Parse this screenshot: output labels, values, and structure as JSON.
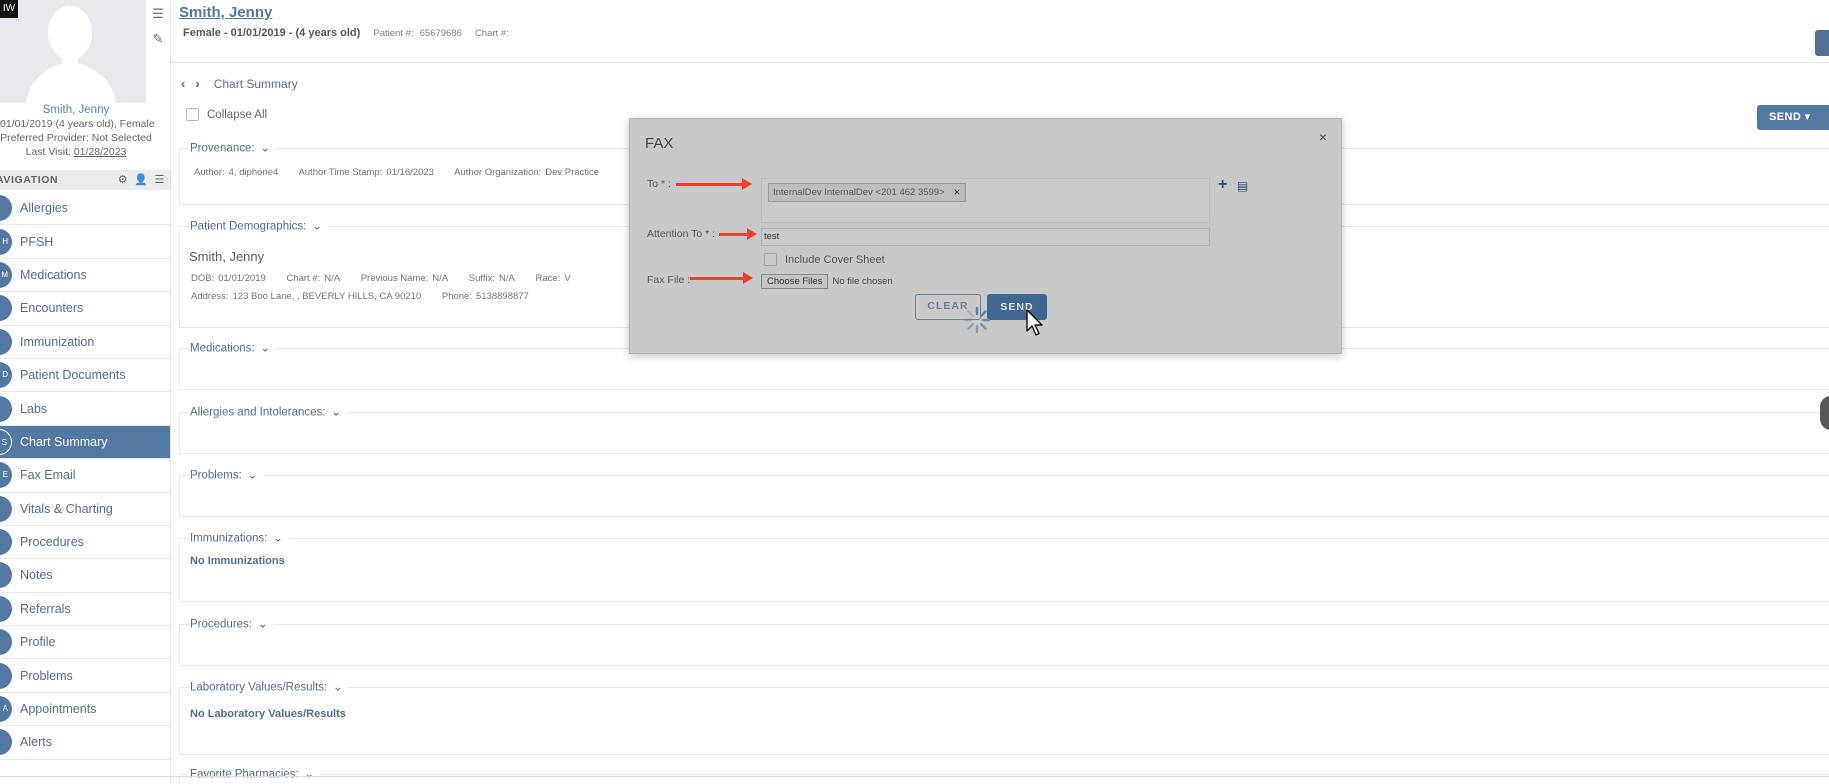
{
  "patient": {
    "name": "Smith, Jenny",
    "summary": "Female - 01/01/2019 - (4 years old)",
    "patient_no_label": "Patient #:",
    "patient_no": "65679686",
    "chart_no_label": "Chart #:"
  },
  "sidebar": {
    "corner_badge": "IW",
    "name": "Smith, Jenny",
    "dob_line": "01/01/2019 (4 years old), Female",
    "provider_line": "Preferred Provider: Not Selected",
    "last_visit_label": "Last Visit:",
    "last_visit_date": "01/28/2023",
    "nav_title": "AVIGATION",
    "items": [
      {
        "badge": "",
        "label": "Allergies"
      },
      {
        "badge": "H",
        "label": "PFSH"
      },
      {
        "badge": "M",
        "label": "Medications"
      },
      {
        "badge": "",
        "label": "Encounters"
      },
      {
        "badge": "",
        "label": "Immunization"
      },
      {
        "badge": "D",
        "label": "Patient Documents"
      },
      {
        "badge": "",
        "label": "Labs"
      },
      {
        "badge": "S",
        "label": "Chart Summary"
      },
      {
        "badge": "E",
        "label": "Fax Email"
      },
      {
        "badge": "",
        "label": "Vitals & Charting"
      },
      {
        "badge": "",
        "label": "Procedures"
      },
      {
        "badge": "",
        "label": "Notes"
      },
      {
        "badge": "",
        "label": "Referrals"
      },
      {
        "badge": "",
        "label": "Profile"
      },
      {
        "badge": "",
        "label": "Problems"
      },
      {
        "badge": "A",
        "label": "Appointments"
      },
      {
        "badge": "",
        "label": "Alerts"
      }
    ]
  },
  "main": {
    "breadcrumb": "Chart Summary",
    "collapse_all": "Collapse All",
    "send_label": "SEND",
    "sections": {
      "provenance": {
        "title": "Provenance:",
        "author_label": "Author:",
        "author": "4, diphone4",
        "timestamp_label": "Author Time Stamp:",
        "timestamp": "01/16/2023",
        "org_label": "Author Organization:",
        "org": "Dev Practice"
      },
      "demographics": {
        "title": "Patient Demographics:",
        "name": "Smith, Jenny",
        "dob_label": "DOB:",
        "dob": "01/01/2019",
        "chart_label": "Chart #:",
        "chart": "N/A",
        "prev_label": "Previous Name:",
        "prev": "N/A",
        "suffix_label": "Suffix:",
        "suffix": "N/A",
        "race_label": "Race:",
        "race": "V",
        "address_label": "Address:",
        "address": "123 Boo Lane, , BEVERLY HILLS, CA 90210",
        "phone_label": "Phone:",
        "phone": "5138898877"
      },
      "medications": {
        "title": "Medications:"
      },
      "allergies": {
        "title": "Allergies and Intolerances:"
      },
      "problems": {
        "title": "Problems:"
      },
      "immunizations": {
        "title": "Immunizations:",
        "body": "No Immunizations"
      },
      "procedures": {
        "title": "Procedures:"
      },
      "labs": {
        "title": "Laboratory Values/Results:",
        "body": "No Laboratory Values/Results"
      },
      "pharmacies": {
        "title": "Favorite Pharmacies:"
      }
    }
  },
  "fax_modal": {
    "title": "FAX",
    "close": "×",
    "to_label": "To * :",
    "to_recipient": "InternalDev InternalDev <201 462 3599>",
    "attention_label": "Attention To * :",
    "attention_value": "test",
    "cover_label": "Include Cover Sheet",
    "file_label": "Fax File :",
    "choose_files": "Choose Files",
    "no_file": "No file chosen",
    "clear_label": "CLEAR",
    "send_label": "SEND"
  },
  "colors": {
    "primary": "#2b5c8e",
    "annotation_arrow": "#e8432b",
    "modal_bg": "#c9c9c9"
  }
}
